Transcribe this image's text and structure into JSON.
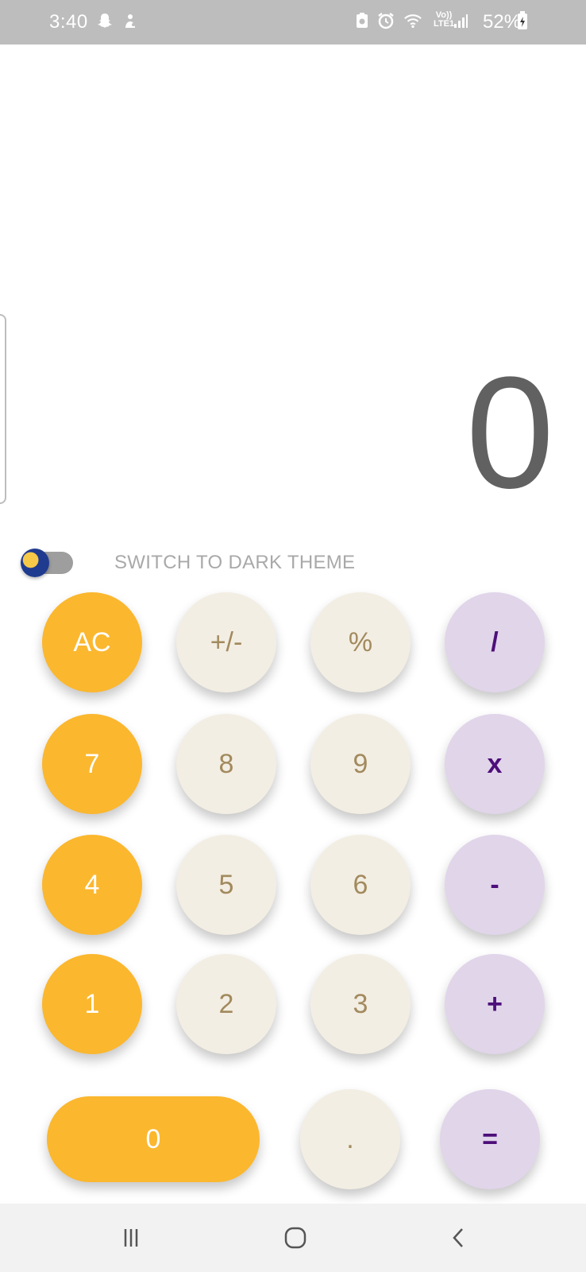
{
  "status_bar": {
    "time": "3:40",
    "battery": "52%",
    "network_label_top": "Vo))",
    "network_label_bottom": "LTE1",
    "icons": [
      "snapchat-icon",
      "notification-icon",
      "battery-saver-icon",
      "alarm-icon",
      "wifi-icon",
      "signal-icon",
      "battery-icon"
    ]
  },
  "display": {
    "value": "0"
  },
  "theme_switch": {
    "label": "SWITCH TO DARK THEME",
    "checked": false
  },
  "keys": {
    "ac": "AC",
    "sign": "+/-",
    "percent": "%",
    "divide": "/",
    "seven": "7",
    "eight": "8",
    "nine": "9",
    "multiply": "x",
    "four": "4",
    "five": "5",
    "six": "6",
    "minus": "-",
    "one": "1",
    "two": "2",
    "three": "3",
    "plus": "+",
    "zero": "0",
    "dot": ".",
    "equals": "="
  },
  "colors": {
    "orange": "#fbb72e",
    "cream": "#f3eee3",
    "lilac": "#e1d5ea",
    "operator_text": "#4d0f7a",
    "digit_text": "#a28a5e",
    "display_text": "#616161"
  },
  "nav_bar": {
    "icons": [
      "recent-apps-icon",
      "home-icon",
      "back-icon"
    ]
  }
}
